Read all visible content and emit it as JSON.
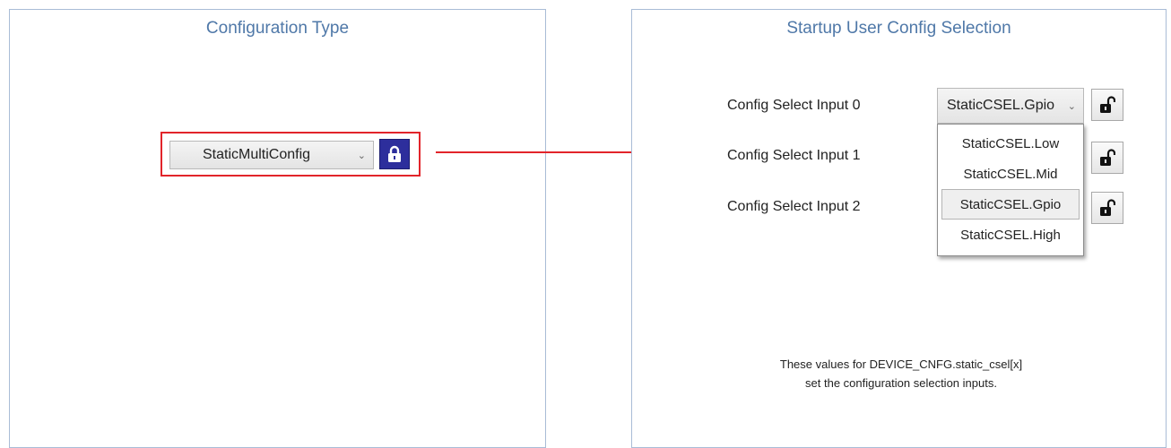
{
  "left_panel": {
    "title": "Configuration Type",
    "config_type": {
      "value": "StaticMultiConfig",
      "lock_state": "locked"
    }
  },
  "right_panel": {
    "title": "Startup User Config Selection",
    "rows": [
      {
        "label": "Config Select Input 0",
        "value": "StaticCSEL.Gpio",
        "lock_state": "unlocked"
      },
      {
        "label": "Config Select Input 1",
        "lock_state": "unlocked"
      },
      {
        "label": "Config Select Input 2",
        "lock_state": "unlocked"
      }
    ],
    "dropdown_options": [
      "StaticCSEL.Low",
      "StaticCSEL.Mid",
      "StaticCSEL.Gpio",
      "StaticCSEL.High"
    ],
    "dropdown_selected": "StaticCSEL.Gpio",
    "note_line1": "These values for DEVICE_CNFG.static_csel[x]",
    "note_line2": "set the configuration selection inputs."
  },
  "icons": {
    "chevron": "chevron-down-icon",
    "lock": "lock-icon",
    "unlock": "unlock-icon",
    "arrow": "arrow-right-icon"
  },
  "colors": {
    "title": "#4f78a8",
    "highlight_frame": "#e2242a",
    "lock_button": "#2d2e9c",
    "arrow": "#e2242a",
    "panel_border": "#a9bcd6"
  }
}
